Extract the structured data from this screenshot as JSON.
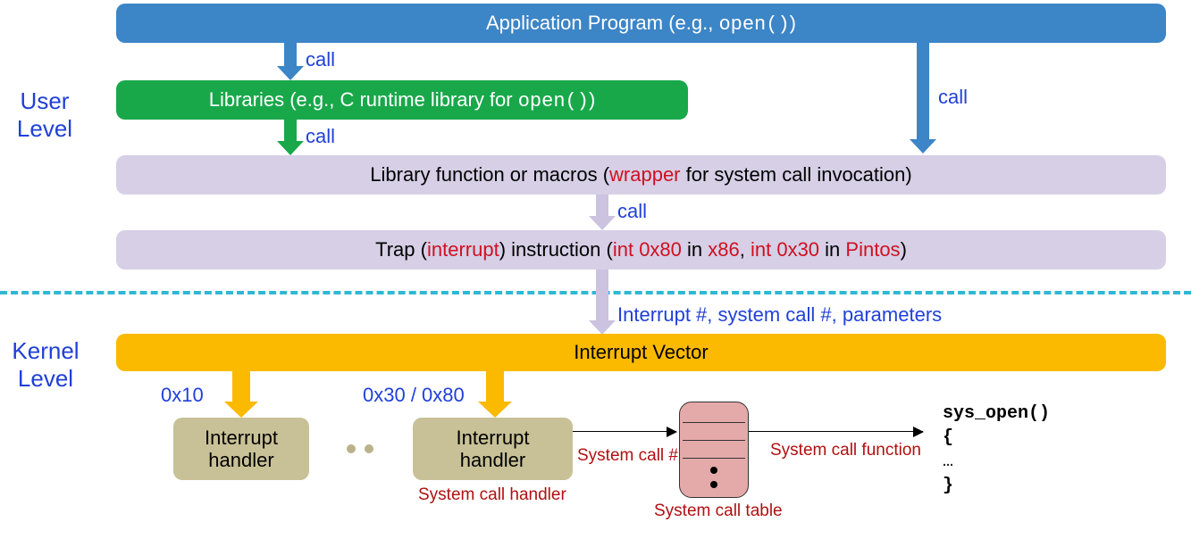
{
  "labels": {
    "user_level": "User\nLevel",
    "kernel_level": "Kernel\nLevel",
    "call": "call",
    "interrupt_params": "Interrupt #, system call #, parameters",
    "addr_0x10": "0x10",
    "addr_0x30_0x80": "0x30 / 0x80",
    "interrupt_handler": "Interrupt\nhandler",
    "system_call_handler": "System call handler",
    "system_call_number": "System call #",
    "system_call_table": "System call table",
    "system_call_function": "System call function"
  },
  "boxes": {
    "app_program": {
      "pre": "Application Program (e.g., ",
      "code": "open()",
      "post": ")"
    },
    "libraries": {
      "pre": "Libraries (e.g., C runtime library for ",
      "code": "open()",
      "post": ")"
    },
    "lib_func": {
      "pre": "Library function or macros (",
      "red1": "wrapper",
      "post1": " for system call invocation)"
    },
    "trap": {
      "pre": "Trap (",
      "red1": "interrupt",
      "mid1": ") instruction (",
      "red2": "int 0x80",
      "mid2": " in ",
      "red3": "x86",
      "mid3": ", ",
      "red4": "int 0x30",
      "mid4": " in ",
      "red5": "Pintos",
      "post": ")"
    },
    "interrupt_vector": "Interrupt Vector"
  },
  "code": {
    "l1": "sys_open()",
    "l2": "{",
    "l3": "  …",
    "l4": "}"
  },
  "colors": {
    "blue": "#3c85c7",
    "green": "#18a84a",
    "lavender": "#d6cfe6",
    "yellow": "#fbb900",
    "olive": "#c8c197",
    "pink": "#e4a9a9"
  }
}
